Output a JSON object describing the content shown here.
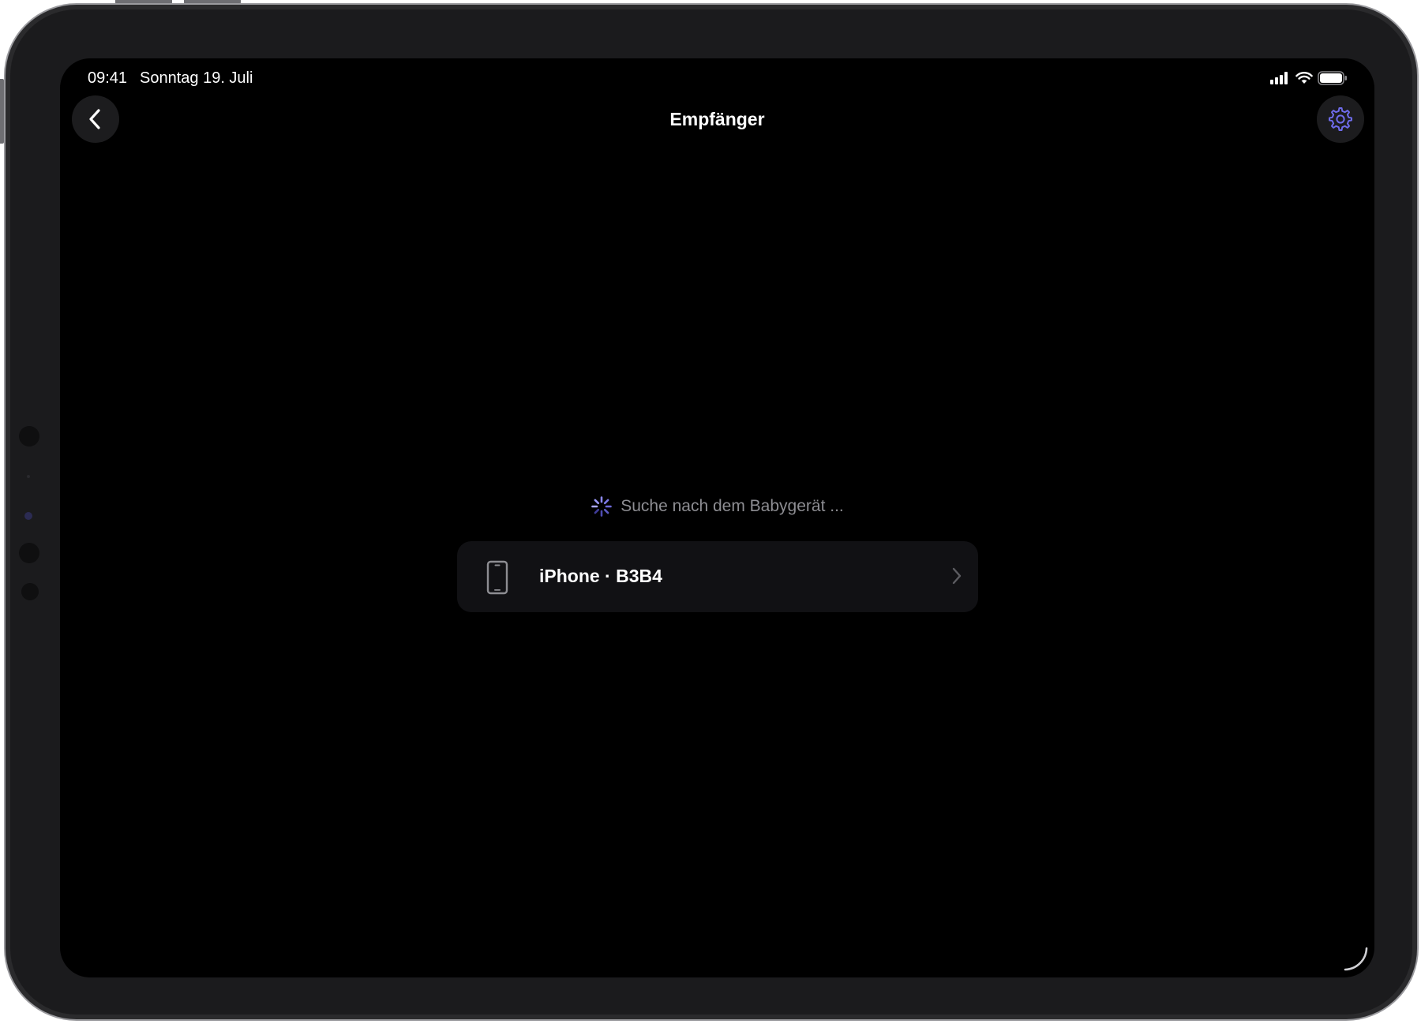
{
  "status_bar": {
    "time": "09:41",
    "date": "Sonntag 19. Juli",
    "icons": [
      "cellular-signal-icon",
      "wifi-icon",
      "battery-icon"
    ]
  },
  "navigation": {
    "title": "Empfänger",
    "back_icon": "chevron-left-icon",
    "settings_icon": "gear-icon"
  },
  "search_status": {
    "text": "Suche nach dem Babygerät ...",
    "icon": "activity-spinner-icon"
  },
  "devices": [
    {
      "name": "iPhone · B3B4",
      "icon": "iphone-icon",
      "disclosure_icon": "chevron-right-icon"
    }
  ],
  "colors": {
    "background": "#000000",
    "card": "#111114",
    "accent": "#6e6bea",
    "secondary_text": "#8d8d92"
  }
}
